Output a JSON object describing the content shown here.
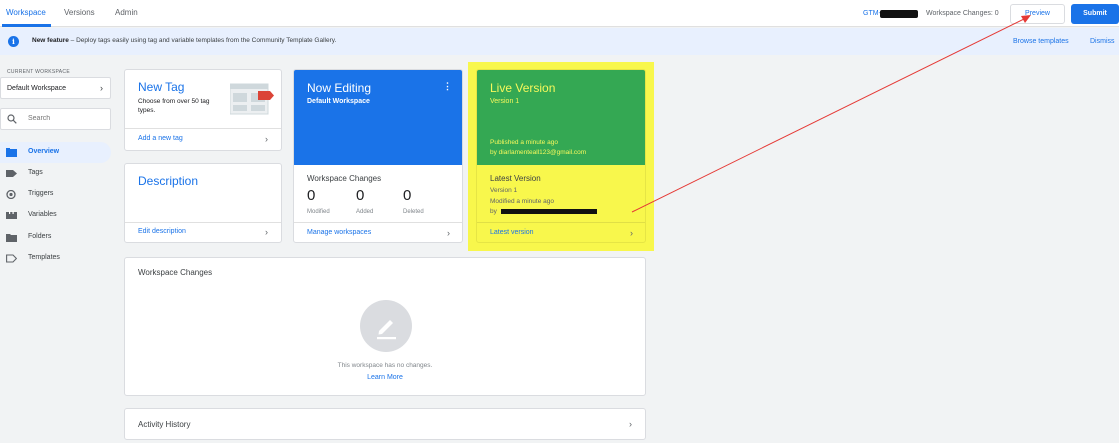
{
  "header": {
    "tabs": [
      {
        "label": "Workspace",
        "active": true
      },
      {
        "label": "Versions",
        "active": false
      },
      {
        "label": "Admin",
        "active": false
      }
    ],
    "container_id": "GTM-",
    "workspace_changes": "Workspace Changes: 0",
    "preview_label": "Preview",
    "submit_label": "Submit"
  },
  "banner": {
    "title": "New feature",
    "text": " – Deploy tags easily using tag and variable templates from the Community Template Gallery.",
    "browse_label": "Browse templates",
    "dismiss_label": "Dismiss"
  },
  "sidebar": {
    "current_workspace_label": "CURRENT WORKSPACE",
    "workspace_name": "Default Workspace",
    "search_placeholder": "Search",
    "items": [
      {
        "label": "Overview",
        "icon": "overview-icon",
        "active": true
      },
      {
        "label": "Tags",
        "icon": "tag-icon",
        "active": false
      },
      {
        "label": "Triggers",
        "icon": "trigger-icon",
        "active": false
      },
      {
        "label": "Variables",
        "icon": "variables-icon",
        "active": false
      },
      {
        "label": "Folders",
        "icon": "folder-icon",
        "active": false
      },
      {
        "label": "Templates",
        "icon": "templates-icon",
        "active": false
      }
    ]
  },
  "new_tag_card": {
    "title": "New Tag",
    "description": "Choose from over 50 tag types.",
    "link": "Add a new tag"
  },
  "description_card": {
    "title": "Description",
    "link": "Edit description"
  },
  "now_editing_card": {
    "title": "Now Editing",
    "workspace": "Default Workspace",
    "changes_title": "Workspace Changes",
    "counts": [
      {
        "value": "0",
        "label": "Modified"
      },
      {
        "value": "0",
        "label": "Added"
      },
      {
        "value": "0",
        "label": "Deleted"
      }
    ],
    "link": "Manage workspaces"
  },
  "live_version_card": {
    "title": "Live Version",
    "version": "Version 1",
    "published": "Published a minute ago",
    "published_by": "by diarlamenteall123@gmail.com",
    "latest_title": "Latest Version",
    "latest_version": "Version 1",
    "modified": "Modified a minute ago",
    "by_prefix": "by",
    "link": "Latest version"
  },
  "workspace_changes_card": {
    "title": "Workspace Changes",
    "empty_text": "This workspace has no changes.",
    "learn_more": "Learn More"
  },
  "activity_history": {
    "title": "Activity History"
  },
  "colors": {
    "accent": "#1a73e8",
    "live_green": "#34a853",
    "highlight_yellow": "#f8f74c",
    "annotation_red": "#e53935"
  }
}
